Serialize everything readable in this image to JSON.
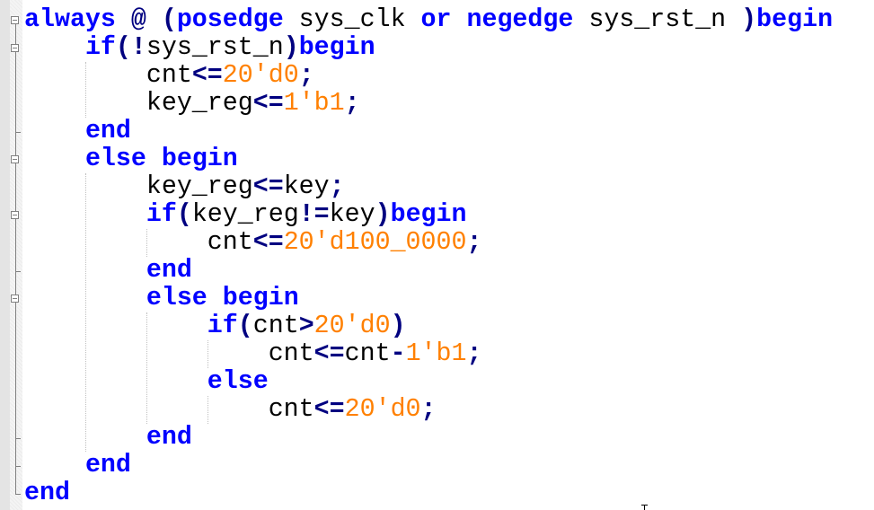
{
  "editor": {
    "language": "verilog",
    "colors": {
      "keyword": "#0000ff",
      "operator": "#000080",
      "number": "#ff8000",
      "identifier": "#000000",
      "background": "#ffffff"
    },
    "lines": [
      {
        "indent": 0,
        "tokens": [
          {
            "t": "kw",
            "v": "always"
          },
          {
            "t": "id",
            "v": " "
          },
          {
            "t": "op",
            "v": "@"
          },
          {
            "t": "id",
            "v": " "
          },
          {
            "t": "op",
            "v": "("
          },
          {
            "t": "kw",
            "v": "posedge"
          },
          {
            "t": "id",
            "v": " sys_clk "
          },
          {
            "t": "kw",
            "v": "or"
          },
          {
            "t": "id",
            "v": " "
          },
          {
            "t": "kw",
            "v": "negedge"
          },
          {
            "t": "id",
            "v": " sys_rst_n "
          },
          {
            "t": "op",
            "v": ")"
          },
          {
            "t": "kw",
            "v": "begin"
          }
        ]
      },
      {
        "indent": 1,
        "tokens": [
          {
            "t": "kw",
            "v": "if"
          },
          {
            "t": "op",
            "v": "(!"
          },
          {
            "t": "id",
            "v": "sys_rst_n"
          },
          {
            "t": "op",
            "v": ")"
          },
          {
            "t": "kw",
            "v": "begin"
          }
        ]
      },
      {
        "indent": 2,
        "tokens": [
          {
            "t": "id",
            "v": "cnt"
          },
          {
            "t": "op",
            "v": "<="
          },
          {
            "t": "num",
            "v": "20'd0"
          },
          {
            "t": "op",
            "v": ";"
          }
        ]
      },
      {
        "indent": 2,
        "tokens": [
          {
            "t": "id",
            "v": "key_reg"
          },
          {
            "t": "op",
            "v": "<="
          },
          {
            "t": "num",
            "v": "1'b1"
          },
          {
            "t": "op",
            "v": ";"
          }
        ]
      },
      {
        "indent": 1,
        "tokens": [
          {
            "t": "kw",
            "v": "end"
          }
        ]
      },
      {
        "indent": 1,
        "tokens": [
          {
            "t": "kw",
            "v": "else"
          },
          {
            "t": "id",
            "v": " "
          },
          {
            "t": "kw",
            "v": "begin"
          }
        ]
      },
      {
        "indent": 2,
        "tokens": [
          {
            "t": "id",
            "v": "key_reg"
          },
          {
            "t": "op",
            "v": "<="
          },
          {
            "t": "id",
            "v": "key"
          },
          {
            "t": "op",
            "v": ";"
          }
        ]
      },
      {
        "indent": 2,
        "tokens": [
          {
            "t": "kw",
            "v": "if"
          },
          {
            "t": "op",
            "v": "("
          },
          {
            "t": "id",
            "v": "key_reg"
          },
          {
            "t": "op",
            "v": "!="
          },
          {
            "t": "id",
            "v": "key"
          },
          {
            "t": "op",
            "v": ")"
          },
          {
            "t": "kw",
            "v": "begin"
          }
        ]
      },
      {
        "indent": 3,
        "tokens": [
          {
            "t": "id",
            "v": "cnt"
          },
          {
            "t": "op",
            "v": "<="
          },
          {
            "t": "num",
            "v": "20'd100_0000"
          },
          {
            "t": "op",
            "v": ";"
          }
        ]
      },
      {
        "indent": 2,
        "tokens": [
          {
            "t": "kw",
            "v": "end"
          }
        ]
      },
      {
        "indent": 2,
        "tokens": [
          {
            "t": "kw",
            "v": "else"
          },
          {
            "t": "id",
            "v": " "
          },
          {
            "t": "kw",
            "v": "begin"
          }
        ]
      },
      {
        "indent": 3,
        "tokens": [
          {
            "t": "kw",
            "v": "if"
          },
          {
            "t": "op",
            "v": "("
          },
          {
            "t": "id",
            "v": "cnt"
          },
          {
            "t": "op",
            "v": ">"
          },
          {
            "t": "num",
            "v": "20'd0"
          },
          {
            "t": "op",
            "v": ")"
          }
        ]
      },
      {
        "indent": 4,
        "tokens": [
          {
            "t": "id",
            "v": "cnt"
          },
          {
            "t": "op",
            "v": "<="
          },
          {
            "t": "id",
            "v": "cnt"
          },
          {
            "t": "op",
            "v": "-"
          },
          {
            "t": "num",
            "v": "1'b1"
          },
          {
            "t": "op",
            "v": ";"
          }
        ]
      },
      {
        "indent": 3,
        "tokens": [
          {
            "t": "kw",
            "v": "else"
          }
        ]
      },
      {
        "indent": 4,
        "tokens": [
          {
            "t": "id",
            "v": "cnt"
          },
          {
            "t": "op",
            "v": "<="
          },
          {
            "t": "num",
            "v": "20'd0"
          },
          {
            "t": "op",
            "v": ";"
          }
        ]
      },
      {
        "indent": 2,
        "tokens": [
          {
            "t": "kw",
            "v": "end"
          }
        ]
      },
      {
        "indent": 1,
        "tokens": [
          {
            "t": "kw",
            "v": "end"
          }
        ]
      },
      {
        "indent": 0,
        "tokens": [
          {
            "t": "kw",
            "v": "end"
          }
        ]
      }
    ],
    "fold_markers": [
      {
        "line": 0,
        "type": "collapse"
      },
      {
        "line": 1,
        "type": "collapse"
      },
      {
        "line": 4,
        "type": "end"
      },
      {
        "line": 5,
        "type": "collapse"
      },
      {
        "line": 7,
        "type": "collapse"
      },
      {
        "line": 9,
        "type": "end"
      },
      {
        "line": 10,
        "type": "collapse"
      },
      {
        "line": 15,
        "type": "end"
      },
      {
        "line": 16,
        "type": "end"
      },
      {
        "line": 17,
        "type": "last"
      }
    ]
  }
}
